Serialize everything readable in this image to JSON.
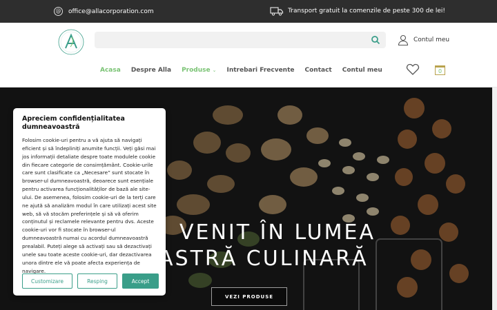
{
  "topbar": {
    "email": "office@allacorporation.com",
    "shipping": "Transport gratuit la comenzile de peste 300 de lei!"
  },
  "header": {
    "search_placeholder": "",
    "account_label": "Contul meu",
    "cart_count": "0"
  },
  "nav": {
    "items": [
      {
        "label": "Acasa"
      },
      {
        "label": "Despre Alla"
      },
      {
        "label": "Produse"
      },
      {
        "label": "Intrebari Frecvente"
      },
      {
        "label": "Contact"
      },
      {
        "label": "Contul meu"
      }
    ]
  },
  "hero": {
    "title_line1": "VENIT ÎN LUMEA",
    "title_line2": "ASTRĂ CULINARĂ",
    "button": "VEZI PRODUSE"
  },
  "cookie": {
    "title": "Apreciem confidențialitatea dumneavoastră",
    "body": "Folosim cookie-uri pentru a vă ajuta să navigați eficient și să îndepliniți anumite funcții. Veți găsi mai jos informații detaliate despre toate modulele cookie din fiecare categorie de consimțământ. Cookie-urile care sunt clasificate ca „Necesare” sunt stocate în browser-ul dumneavoastră, deoarece sunt esențiale pentru activarea funcționalităților de bază ale site-ului. De asemenea, folosim cookie-uri de la terți care ne ajută să analizăm modul în care utilizați acest site web, să vă stocăm preferințele și să vă oferim conținutul și reclamele relevante pentru dvs. Aceste cookie-uri vor fi stocate în browser-ul dumneavoastră numai cu acordul dumneavoastră prealabil. Puteți alege să activați sau să dezactivați unele sau toate aceste cookie-uri, dar dezactivarea unora dintre ele vă poate afecta experiența de navigare.",
    "customize": "Customizare",
    "reject": "Resping",
    "accept": "Accept"
  },
  "colors": {
    "accent": "#7ac374",
    "teal": "#3a9e89",
    "topbar": "#2e2e2e"
  }
}
